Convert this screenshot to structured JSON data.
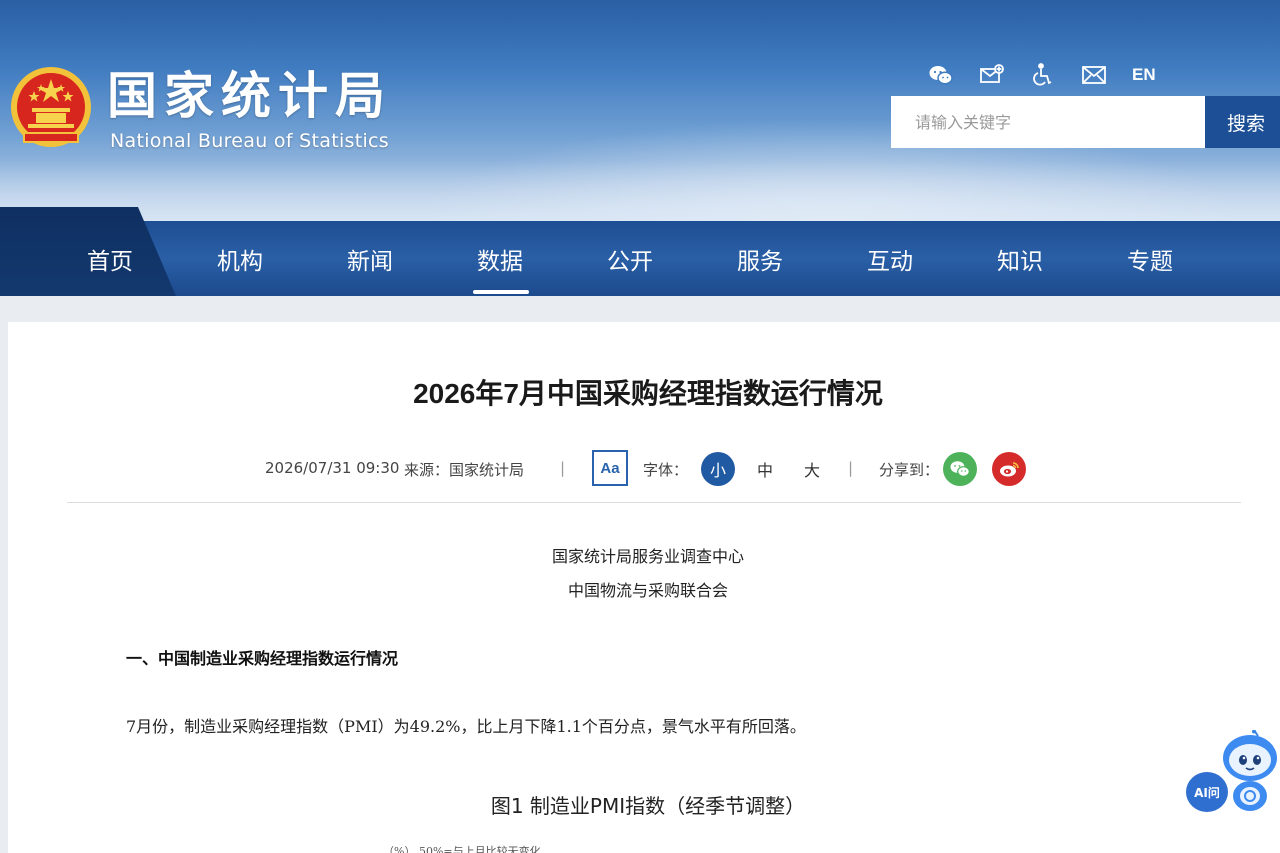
{
  "header": {
    "logo_cn": "国家统计局",
    "logo_en": "National Bureau of Statistics",
    "icons": [
      "wechat-icon",
      "mail-subscribe-icon",
      "accessibility-icon",
      "mail-icon"
    ],
    "lang": "EN",
    "search_placeholder": "请输入关键字",
    "search_button": "搜索"
  },
  "nav": {
    "items": [
      {
        "label": "首页"
      },
      {
        "label": "机构"
      },
      {
        "label": "新闻"
      },
      {
        "label": "数据"
      },
      {
        "label": "公开"
      },
      {
        "label": "服务"
      },
      {
        "label": "互动"
      },
      {
        "label": "知识"
      },
      {
        "label": "专题"
      }
    ],
    "active": "数据"
  },
  "article": {
    "title": "2026年7月中国采购经理指数运行情况",
    "date": "2026/07/31 09:30",
    "source": "来源：国家统计局",
    "aa_label": "Aa",
    "font_label": "字体：",
    "font_small": "小",
    "font_medium": "中",
    "font_large": "大",
    "share_label": "分享到：",
    "separator": "|",
    "source_line1": "国家统计局服务业调查中心",
    "source_line2": "中国物流与采购联合会",
    "section_heading": "一、中国制造业采购经理指数运行情况",
    "paragraph": "7月份，制造业采购经理指数（PMI）为49.2%，比上月下降1.1个百分点，景气水平有所回落。",
    "figure_title": "图1  制造业PMI指数（经季节调整）",
    "figure_sub": "（%）  50%=与上月比较无变化"
  },
  "ai_widget": {
    "label": "AI问"
  },
  "colors": {
    "nav_bg": "#1e4e93",
    "search_button": "#1d4f96",
    "accent": "#1f5aa3",
    "wechat": "#4eb25b",
    "weibo": "#d52b2b"
  }
}
